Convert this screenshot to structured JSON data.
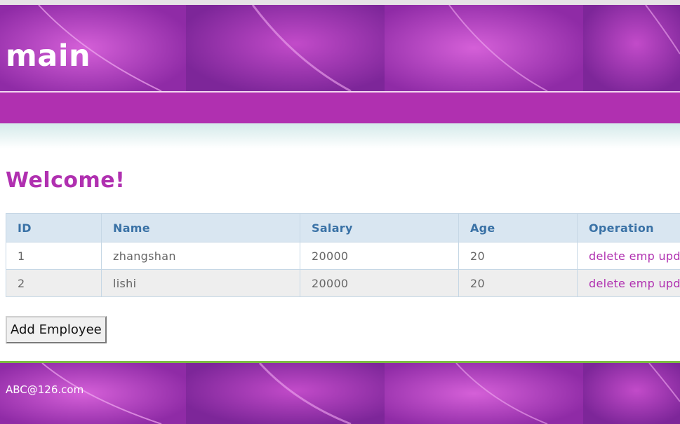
{
  "header": {
    "title": "main"
  },
  "main": {
    "heading": "Welcome!",
    "table": {
      "columns": [
        "ID",
        "Name",
        "Salary",
        "Age",
        "Operation"
      ],
      "rows": [
        {
          "id": "1",
          "name": "zhangshan",
          "salary": "20000",
          "age": "20",
          "delete_label": "delete emp",
          "update_label": "update emp"
        },
        {
          "id": "2",
          "name": "lishi",
          "salary": "20000",
          "age": "20",
          "delete_label": "delete emp",
          "update_label": "update emp"
        }
      ]
    },
    "add_button_label": "Add Employee"
  },
  "footer": {
    "email": "ABC@126.com"
  },
  "colors": {
    "brand_purple": "#b030b0",
    "banner_purple": "#8f2ba6",
    "table_header_bg": "#d9e6f1",
    "table_header_text": "#3a72a6",
    "footer_accent": "#7dbb45"
  }
}
